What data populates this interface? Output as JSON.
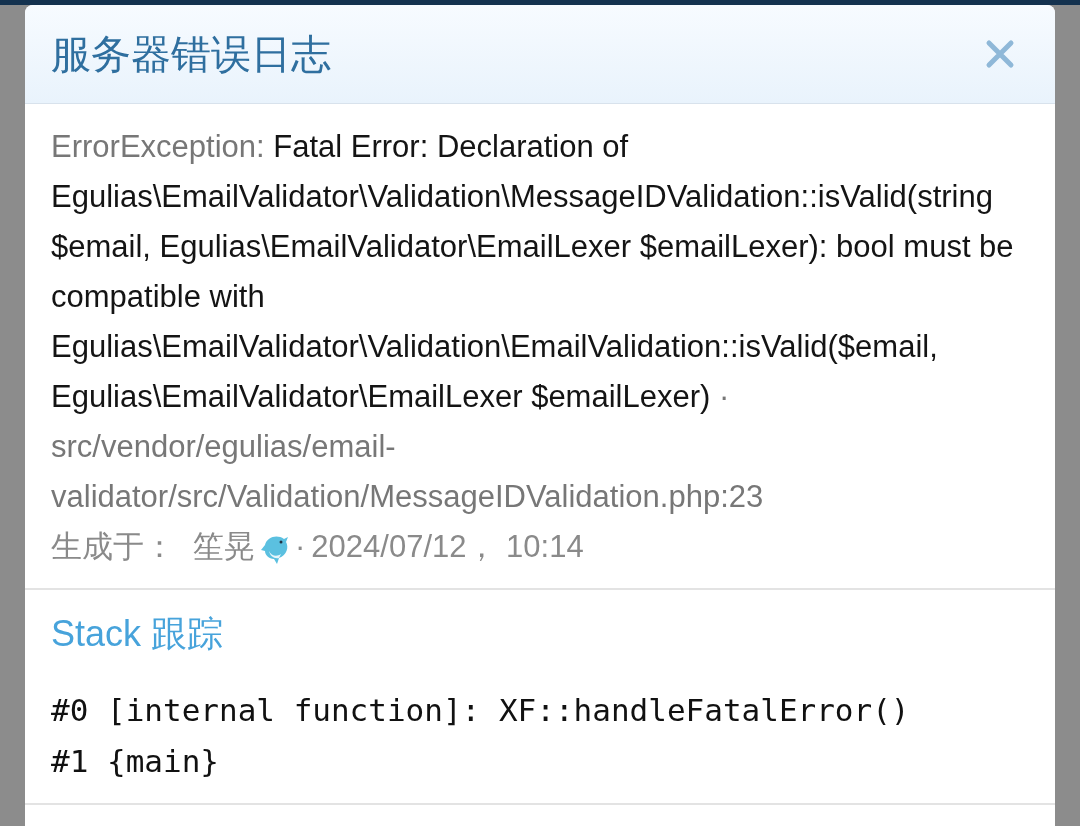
{
  "dialog": {
    "title": "服务器错误日志"
  },
  "error": {
    "type": "ErrorException:",
    "message": "Fatal Error: Declaration of Egulias\\EmailValidator\\Validation\\MessageIDValidation::isValid(string $email, Egulias\\EmailValidator\\EmailLexer $emailLexer): bool must be compatible with Egulias\\EmailValidator\\Validation\\EmailValidation::isValid($email, Egulias\\EmailValidator\\EmailLexer $emailLexer)",
    "separator": "·",
    "file": "src/vendor/egulias/email-validator/src/Validation/MessageIDValidation.php:23"
  },
  "meta": {
    "label": "生成于：",
    "user": "笙晃",
    "separator": "·",
    "date": "2024/07/12， 10:14"
  },
  "stack": {
    "title": "Stack 跟踪",
    "lines": [
      "#0 [internal function]: XF::handleFatalError()",
      "#1 {main}"
    ]
  }
}
